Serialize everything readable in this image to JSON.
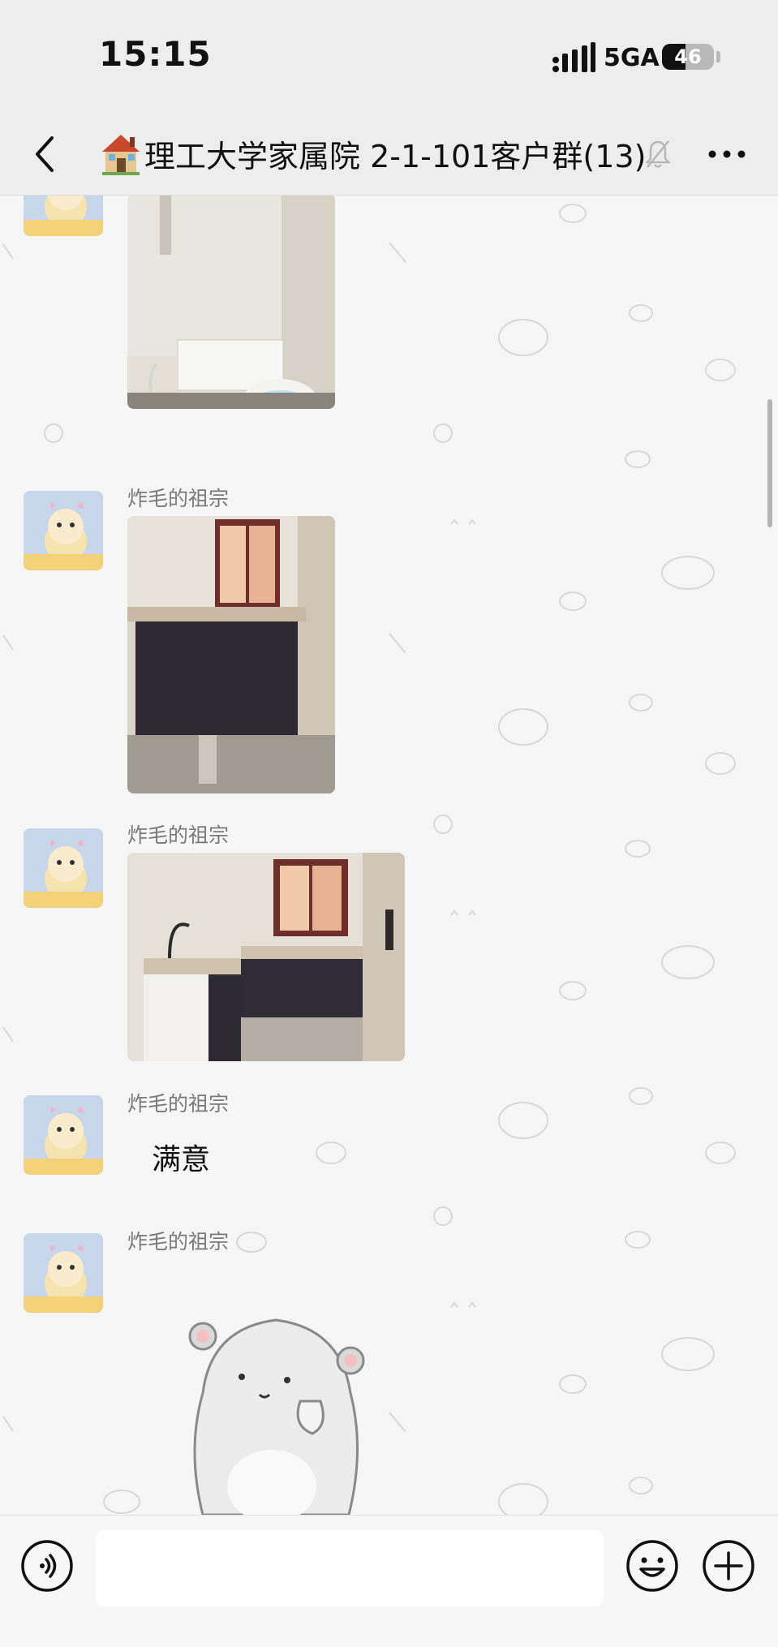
{
  "status_bar": {
    "time": "15:15",
    "network": "5GA",
    "battery_level": "46",
    "battery_fraction": 0.46
  },
  "nav": {
    "back_icon": "chevron-left-icon",
    "title_icon": "house-icon",
    "title": "理工大学家属院 2-1-101客户群(13)",
    "muted_icon": "bell-slash-icon",
    "more_icon": "more-dots-icon"
  },
  "messages": [
    {
      "sender": "炸毛的祖宗",
      "type": "image",
      "content": "kitchen photo"
    },
    {
      "sender": "炸毛的祖宗",
      "type": "image",
      "content": "kitchen photo"
    },
    {
      "sender": "炸毛的祖宗",
      "type": "text",
      "text": "满意"
    },
    {
      "sender": "炸毛的祖宗",
      "type": "sticker",
      "content": "cartoon hamster sticker"
    }
  ],
  "input_bar": {
    "voice_icon": "voice-icon",
    "emoji_icon": "emoji-icon",
    "plus_icon": "plus-circle-icon",
    "placeholder": ""
  },
  "colors": {
    "background": "#f6f6f6",
    "header": "#ededed",
    "sender_text": "#7a7a7a"
  }
}
